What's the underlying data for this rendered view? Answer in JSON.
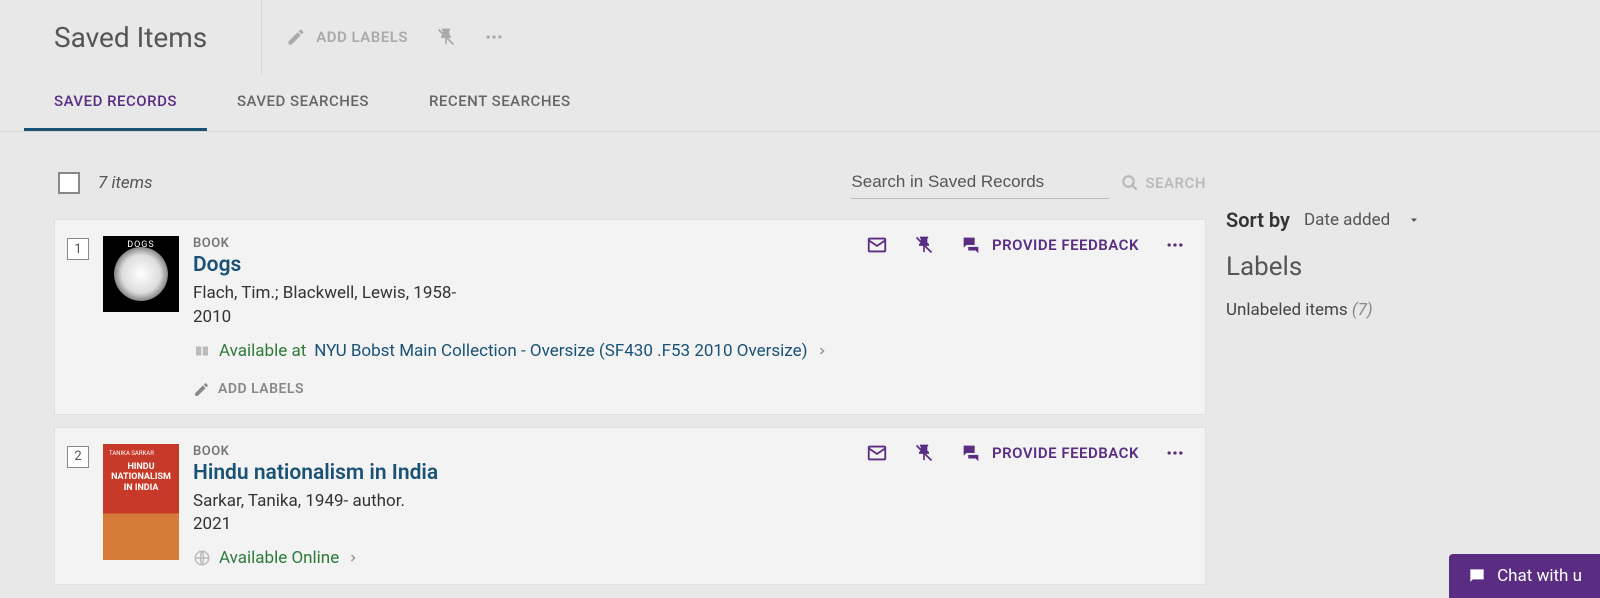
{
  "header": {
    "title": "Saved Items",
    "add_labels": "ADD LABELS"
  },
  "tabs": {
    "saved_records": "SAVED RECORDS",
    "saved_searches": "SAVED SEARCHES",
    "recent_searches": "RECENT SEARCHES"
  },
  "list": {
    "count_label": "7 items",
    "search_placeholder": "Search in Saved Records",
    "search_button": "SEARCH"
  },
  "records": [
    {
      "index": "1",
      "type": "BOOK",
      "title": "Dogs",
      "author": "Flach, Tim.; Blackwell, Lewis, 1958-",
      "year": "2010",
      "avail_prefix": "Available at",
      "avail_location": "NYU Bobst  Main Collection - Oversize (SF430 .F53 2010 Oversize)",
      "add_labels": "ADD LABELS",
      "feedback": "PROVIDE FEEDBACK",
      "thumb_text": "DOGS"
    },
    {
      "index": "2",
      "type": "BOOK",
      "title": "Hindu nationalism in India",
      "author": "Sarkar, Tanika, 1949- author.",
      "year": "2021",
      "avail_prefix": "Available Online",
      "feedback": "PROVIDE FEEDBACK",
      "thumb_author": "TANIKA SARKAR",
      "thumb_title": "HINDU NATIONALISM IN INDIA"
    }
  ],
  "side": {
    "sort_label": "Sort by",
    "sort_value": "Date added",
    "labels_heading": "Labels",
    "unlabeled_text": "Unlabeled items",
    "unlabeled_count": "(7)"
  },
  "chat": {
    "label": "Chat with u"
  }
}
